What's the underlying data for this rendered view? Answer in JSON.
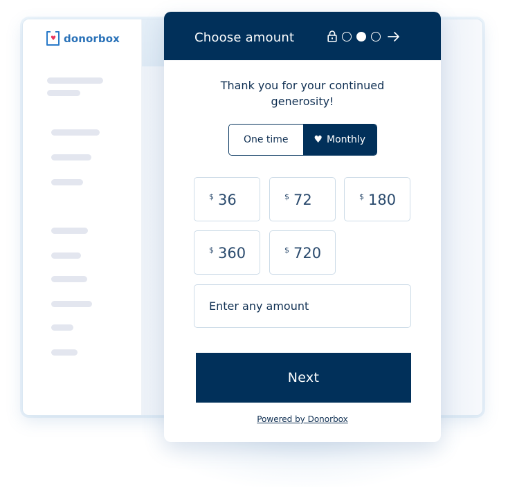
{
  "brand": {
    "name": "donorbox",
    "logo_icon": "heart-box-icon",
    "primary_color": "#01305a",
    "logo_color": "#2a72b8",
    "heart_color": "#e8365d"
  },
  "background_app": {
    "sidebar_placeholder_rows": 12
  },
  "form": {
    "title": "Choose amount",
    "header_icons": {
      "lock": "lock-icon",
      "steps": [
        {
          "state": "inactive"
        },
        {
          "state": "active"
        },
        {
          "state": "inactive"
        }
      ],
      "next": "arrow-right-icon"
    },
    "message": "Thank you for your continued generosity!",
    "frequency": {
      "options": [
        {
          "label": "One time",
          "selected": false
        },
        {
          "label": "Monthly",
          "selected": true,
          "icon": "heart-icon"
        }
      ]
    },
    "currency_symbol": "$",
    "amounts": [
      "36",
      "72",
      "180",
      "360",
      "720"
    ],
    "custom_amount": {
      "placeholder": "Enter any amount",
      "value": ""
    },
    "next_label": "Next",
    "powered_by": "Powered by Donorbox"
  }
}
